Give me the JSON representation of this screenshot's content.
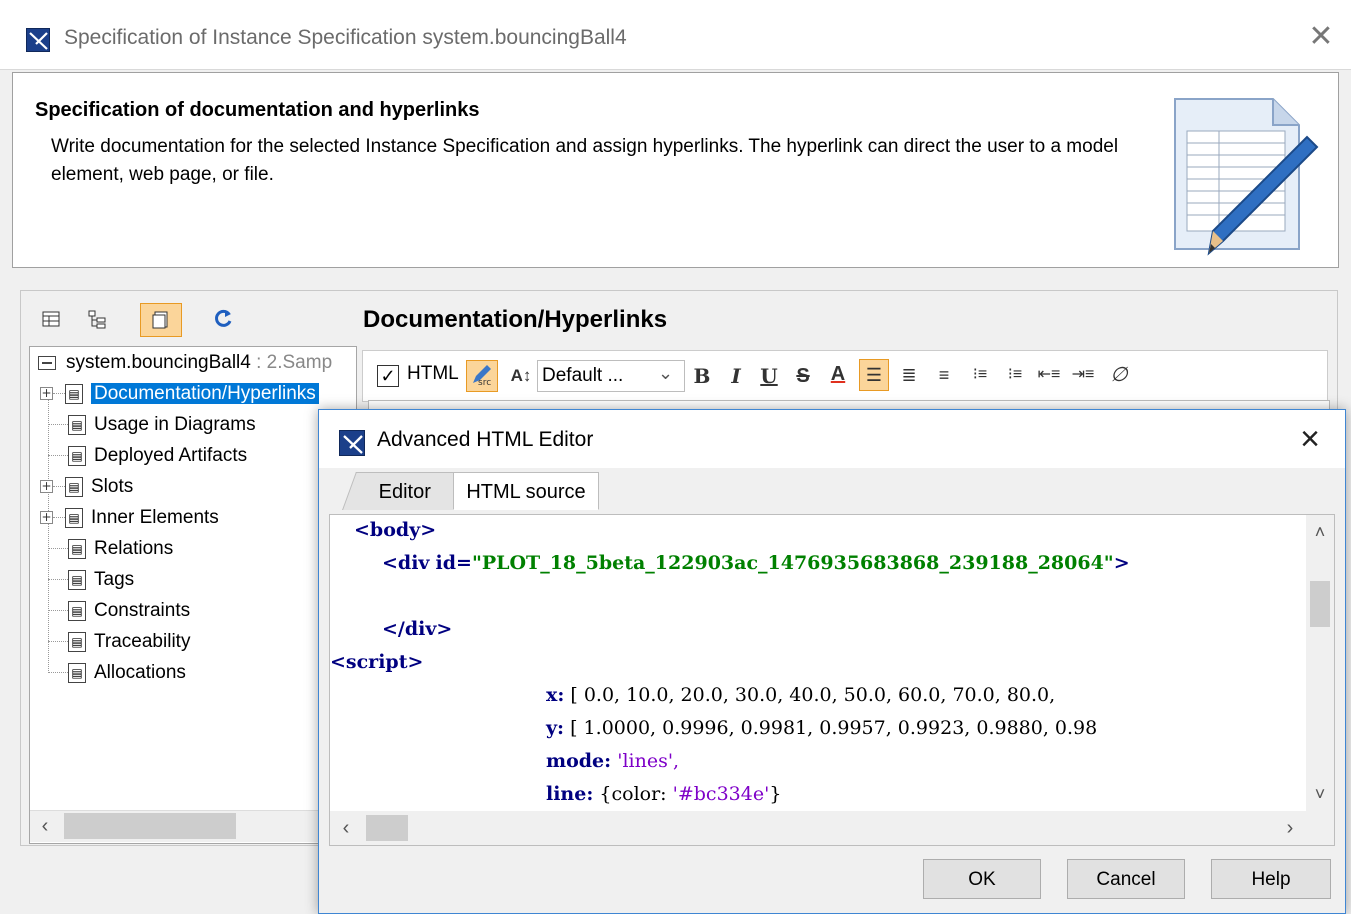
{
  "main_window": {
    "title": "Specification of Instance Specification system.bouncingBall4",
    "close_glyph": "✕"
  },
  "banner": {
    "heading": "Specification of documentation and hyperlinks",
    "description": "Write documentation for the selected Instance Specification and assign hyperlinks. The hyperlink can direct the user to a model element, web page, or file."
  },
  "tree": {
    "root_name": "system.bouncingBall4",
    "root_suffix": " : 2.Samp",
    "items": [
      {
        "label": "Documentation/Hyperlinks",
        "expandable": true,
        "selected": true
      },
      {
        "label": "Usage in Diagrams",
        "expandable": false
      },
      {
        "label": "Deployed Artifacts",
        "expandable": false
      },
      {
        "label": "Slots",
        "expandable": true
      },
      {
        "label": "Inner Elements",
        "expandable": true
      },
      {
        "label": "Relations",
        "expandable": false
      },
      {
        "label": "Tags",
        "expandable": false
      },
      {
        "label": "Constraints",
        "expandable": false
      },
      {
        "label": "Traceability",
        "expandable": false
      },
      {
        "label": "Allocations",
        "expandable": false
      }
    ]
  },
  "main_panel": {
    "title": "Documentation/Hyperlinks",
    "html_checkbox_label": "HTML",
    "font_select_value": "Default ..."
  },
  "toolbar_icons": [
    "table-icon",
    "tree-icon",
    "compact-icon",
    "refresh-icon"
  ],
  "format_icons": [
    "bold-icon",
    "italic-icon",
    "underline-icon",
    "strikethrough-icon",
    "font-color-icon",
    "align-left-icon",
    "align-center-icon",
    "align-right-icon",
    "numbered-list-icon",
    "bullet-list-icon",
    "outdent-icon",
    "indent-icon",
    "link-icon"
  ],
  "modal": {
    "title": "Advanced HTML Editor",
    "tabs": [
      "Editor",
      "HTML source"
    ],
    "active_tab": "HTML source",
    "code": {
      "line1": "<body>",
      "line2_tag_open": "<div",
      "line2_attr": "id=",
      "line2_value": "\"PLOT_18_5beta_122903ac_1476935683868_239188_28064\"",
      "line2_close": ">",
      "line3": "</div>",
      "line4": "<script>",
      "x_key": "x:",
      "x_values": "[ 0.0, 10.0, 20.0, 30.0, 40.0, 50.0, 60.0, 70.0, 80.0,",
      "y_key": "y:",
      "y_values": "[ 1.0000, 0.9996, 0.9981, 0.9957, 0.9923, 0.9880, 0.98",
      "mode_key": "mode:",
      "mode_value": "'lines',",
      "line_key": "line:",
      "line_open": "{color:",
      "line_color": "'#bc334e'",
      "line_close": "}"
    },
    "buttons": {
      "ok": "OK",
      "cancel": "Cancel",
      "help": "Help"
    }
  }
}
